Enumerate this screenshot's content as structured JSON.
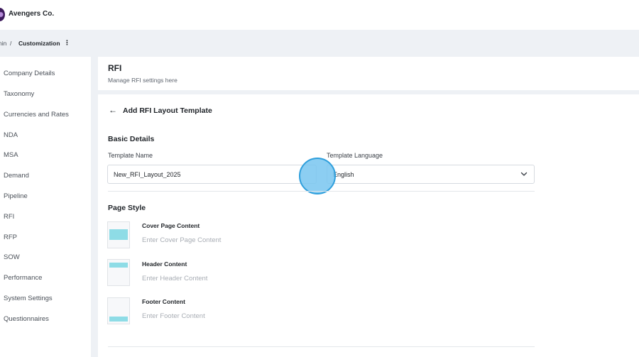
{
  "app": {
    "brand": "Avengers Co."
  },
  "breadcrumb": {
    "previous": "nin",
    "separator": "/",
    "current": "Customization",
    "more": "⋮"
  },
  "sidebar": {
    "items": [
      {
        "label": "Company Details"
      },
      {
        "label": "Taxonomy"
      },
      {
        "label": "Currencies and Rates"
      },
      {
        "label": "NDA"
      },
      {
        "label": "MSA"
      },
      {
        "label": "Demand"
      },
      {
        "label": "Pipeline"
      },
      {
        "label": "RFI"
      },
      {
        "label": "RFP"
      },
      {
        "label": "SOW"
      },
      {
        "label": "Performance"
      },
      {
        "label": "System Settings"
      },
      {
        "label": "Questionnaires"
      }
    ]
  },
  "page": {
    "title": "RFI",
    "subtitle": "Manage RFI settings here"
  },
  "form": {
    "back_icon": "arrow-left-icon",
    "title": "Add RFI Layout Template",
    "basic_details": {
      "heading": "Basic Details",
      "template_name_label": "Template Name",
      "template_name_value": "New_RFI_Layout_2025",
      "template_language_label": "Template Language",
      "template_language_value": "English"
    },
    "page_style": {
      "heading": "Page Style",
      "cover": {
        "title": "Cover Page Content",
        "placeholder": "Enter Cover Page Content"
      },
      "header": {
        "title": "Header Content",
        "placeholder": "Enter Header Content"
      },
      "footer": {
        "title": "Footer Content",
        "placeholder": "Enter Footer Content"
      }
    }
  },
  "colors": {
    "accent": "#8edce6",
    "cursor": "#78c6f0",
    "band": "#eef1f5"
  }
}
